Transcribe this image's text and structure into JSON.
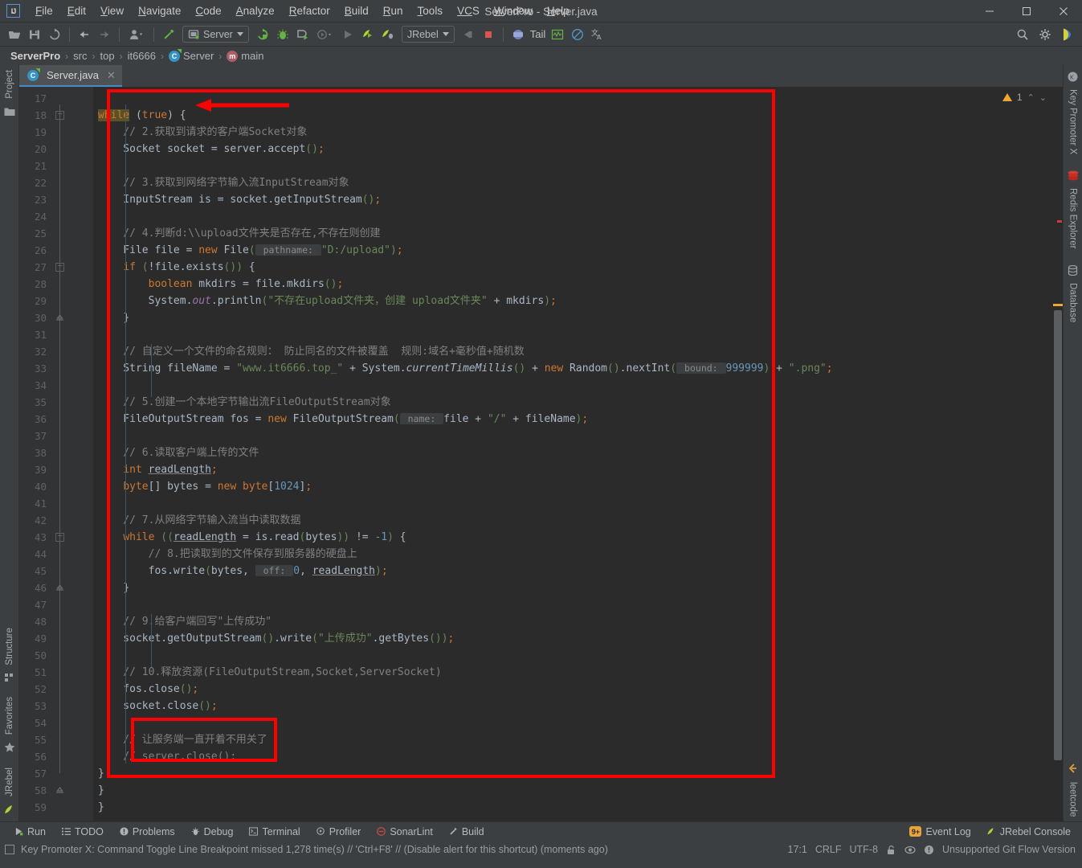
{
  "window": {
    "title": "ServerPro - Server.java",
    "minimize_label": "—",
    "maximize_label": "□",
    "close_label": "✕",
    "logo_text": "IJ"
  },
  "menubar": {
    "items": [
      {
        "label": "File"
      },
      {
        "label": "Edit"
      },
      {
        "label": "View"
      },
      {
        "label": "Navigate"
      },
      {
        "label": "Code"
      },
      {
        "label": "Analyze"
      },
      {
        "label": "Refactor"
      },
      {
        "label": "Build"
      },
      {
        "label": "Run"
      },
      {
        "label": "Tools"
      },
      {
        "label": "VCS"
      },
      {
        "label": "Window"
      },
      {
        "label": "Help"
      }
    ]
  },
  "toolbar": {
    "run_config_label": "Server",
    "jrebel_label": "JRebel",
    "tail_label": "Tail",
    "icons": [
      "open-folder-icon",
      "save-all-icon",
      "sync-icon",
      "back-arrow-icon",
      "forward-arrow-icon",
      "profile-dropdown-icon",
      "build-hammer-icon",
      "run-config-selector",
      "rerun-icon",
      "debug-bug-icon",
      "run-with-coverage-icon",
      "profiler-icon",
      "run-icon",
      "jrebel-run-icon",
      "jrebel-debug-icon",
      "jrebel-selector",
      "stop-gray-icon",
      "stop-red-icon",
      "tail-icon",
      "monitor-icon",
      "forbidden-icon",
      "translate-icon",
      "search-icon",
      "settings-gear-icon",
      "ide-profile-icon"
    ]
  },
  "breadcrumb": {
    "items": [
      {
        "label": "ServerPro",
        "icon": "",
        "bold": true
      },
      {
        "label": "src",
        "icon": ""
      },
      {
        "label": "top",
        "icon": ""
      },
      {
        "label": "it6666",
        "icon": ""
      },
      {
        "label": "Server",
        "icon": "class-icon"
      },
      {
        "label": "main",
        "icon": "method-icon"
      }
    ],
    "separator": "›"
  },
  "editor_tabs": [
    {
      "label": "Server.java",
      "icon": "java-class-icon",
      "close": "✕",
      "active": true
    }
  ],
  "inspection_widget": {
    "warning_count": "1",
    "up_chevron": "⌃",
    "down_chevron": "⌄"
  },
  "left_toolwindows": [
    {
      "label": "Project",
      "icon": "project-folder-icon"
    },
    {
      "label": "Structure",
      "icon": "structure-icon"
    },
    {
      "label": "Favorites",
      "icon": "star-icon"
    },
    {
      "label": "JRebel",
      "icon": "jrebel-leaf-icon"
    }
  ],
  "right_toolwindows": [
    {
      "label": "Key Promoter X",
      "icon": "key-promoter-icon"
    },
    {
      "label": "Redis Explorer",
      "icon": "redis-icon"
    },
    {
      "label": "Database",
      "icon": "database-icon"
    }
  ],
  "code": {
    "first_line_number": 17,
    "lines": [
      {
        "n": 17,
        "fold": "",
        "tokens": []
      },
      {
        "n": 18,
        "fold": "minus",
        "tokens": [
          {
            "t": "while",
            "c": "hl-kw"
          },
          {
            "t": " ",
            "c": "txt"
          },
          {
            "t": "(",
            "c": "pun"
          },
          {
            "t": "true",
            "c": "kw"
          },
          {
            "t": ")",
            "c": "pun"
          },
          {
            "t": " ",
            "c": "txt"
          },
          {
            "t": "{",
            "c": "pun"
          }
        ]
      },
      {
        "n": 19,
        "fold": "",
        "tokens": [
          {
            "t": "    // 2.获取到请求的客户端Socket对象",
            "c": "cmt"
          }
        ]
      },
      {
        "n": 20,
        "fold": "",
        "tokens": [
          {
            "t": "    Socket socket = server.accept",
            "c": "txt"
          },
          {
            "t": "()",
            "c": "grn"
          },
          {
            "t": ";",
            "c": "semi"
          }
        ]
      },
      {
        "n": 21,
        "fold": "",
        "tokens": []
      },
      {
        "n": 22,
        "fold": "",
        "tokens": [
          {
            "t": "    // 3.获取到网络字节输入流InputStream对象",
            "c": "cmt"
          }
        ]
      },
      {
        "n": 23,
        "fold": "",
        "tokens": [
          {
            "t": "    InputStream is = socket.getInputStream",
            "c": "txt"
          },
          {
            "t": "()",
            "c": "grn"
          },
          {
            "t": ";",
            "c": "semi"
          }
        ]
      },
      {
        "n": 24,
        "fold": "",
        "tokens": []
      },
      {
        "n": 25,
        "fold": "",
        "tokens": [
          {
            "t": "    // 4.判断d:\\\\upload文件夹是否存在,不存在则创建",
            "c": "cmt"
          }
        ]
      },
      {
        "n": 26,
        "fold": "",
        "tokens": [
          {
            "t": "    File file = ",
            "c": "txt"
          },
          {
            "t": "new",
            "c": "kw"
          },
          {
            "t": " File",
            "c": "txt"
          },
          {
            "t": "(",
            "c": "grn"
          },
          {
            "t": " pathname: ",
            "c": "hint"
          },
          {
            "t": "\"D:/upload\"",
            "c": "str"
          },
          {
            "t": ")",
            "c": "grn"
          },
          {
            "t": ";",
            "c": "semi"
          }
        ]
      },
      {
        "n": 27,
        "fold": "minus",
        "tokens": [
          {
            "t": "    ",
            "c": "txt"
          },
          {
            "t": "if",
            "c": "kw"
          },
          {
            "t": " ",
            "c": "txt"
          },
          {
            "t": "(",
            "c": "grn"
          },
          {
            "t": "!file.exists",
            "c": "txt"
          },
          {
            "t": "()",
            "c": "grn"
          },
          {
            "t": ")",
            "c": "grn"
          },
          {
            "t": " ",
            "c": "txt"
          },
          {
            "t": "{",
            "c": "pun"
          }
        ]
      },
      {
        "n": 28,
        "fold": "",
        "tokens": [
          {
            "t": "        ",
            "c": "txt"
          },
          {
            "t": "boolean",
            "c": "kw"
          },
          {
            "t": " mkdirs = file.mkdirs",
            "c": "txt"
          },
          {
            "t": "()",
            "c": "grn"
          },
          {
            "t": ";",
            "c": "semi"
          }
        ]
      },
      {
        "n": 29,
        "fold": "",
        "tokens": [
          {
            "t": "        System.",
            "c": "txt"
          },
          {
            "t": "out",
            "c": "fld ital"
          },
          {
            "t": ".println",
            "c": "txt"
          },
          {
            "t": "(",
            "c": "grn"
          },
          {
            "t": "\"不存在upload文件夹，创建 upload文件夹\"",
            "c": "str"
          },
          {
            "t": " + mkdirs",
            "c": "txt"
          },
          {
            "t": ")",
            "c": "grn"
          },
          {
            "t": ";",
            "c": "semi"
          }
        ]
      },
      {
        "n": 30,
        "fold": "end",
        "tokens": [
          {
            "t": "    ",
            "c": "txt"
          },
          {
            "t": "}",
            "c": "pun"
          }
        ]
      },
      {
        "n": 31,
        "fold": "",
        "tokens": []
      },
      {
        "n": 32,
        "fold": "",
        "tokens": [
          {
            "t": "    // 自定义一个文件的命名规则： 防止同名的文件被覆盖  规则:域名+毫秒值+随机数",
            "c": "cmt"
          }
        ]
      },
      {
        "n": 33,
        "fold": "",
        "tokens": [
          {
            "t": "    String fileName = ",
            "c": "txt"
          },
          {
            "t": "\"www.it6666.top_\"",
            "c": "str"
          },
          {
            "t": " + System.",
            "c": "txt"
          },
          {
            "t": "currentTimeMillis",
            "c": "txt ital"
          },
          {
            "t": "()",
            "c": "grn"
          },
          {
            "t": " + ",
            "c": "txt"
          },
          {
            "t": "new",
            "c": "kw"
          },
          {
            "t": " Random",
            "c": "txt"
          },
          {
            "t": "()",
            "c": "grn"
          },
          {
            "t": ".nextInt",
            "c": "txt"
          },
          {
            "t": "(",
            "c": "grn"
          },
          {
            "t": " bound: ",
            "c": "hint"
          },
          {
            "t": "999999",
            "c": "num"
          },
          {
            "t": ")",
            "c": "grn"
          },
          {
            "t": " + ",
            "c": "txt"
          },
          {
            "t": "\".png\"",
            "c": "str"
          },
          {
            "t": ";",
            "c": "semi"
          }
        ]
      },
      {
        "n": 34,
        "fold": "",
        "tokens": []
      },
      {
        "n": 35,
        "fold": "",
        "tokens": [
          {
            "t": "    // 5.创建一个本地字节输出流FileOutputStream对象",
            "c": "cmt"
          }
        ]
      },
      {
        "n": 36,
        "fold": "",
        "tokens": [
          {
            "t": "    FileOutputStream fos = ",
            "c": "txt"
          },
          {
            "t": "new",
            "c": "kw"
          },
          {
            "t": " FileOutputStream",
            "c": "txt"
          },
          {
            "t": "(",
            "c": "grn"
          },
          {
            "t": " name: ",
            "c": "hint"
          },
          {
            "t": "file + ",
            "c": "txt"
          },
          {
            "t": "\"/\"",
            "c": "str"
          },
          {
            "t": " + fileName",
            "c": "txt"
          },
          {
            "t": ")",
            "c": "grn"
          },
          {
            "t": ";",
            "c": "semi"
          }
        ]
      },
      {
        "n": 37,
        "fold": "",
        "tokens": []
      },
      {
        "n": 38,
        "fold": "",
        "tokens": [
          {
            "t": "    // 6.读取客户端上传的文件",
            "c": "cmt"
          }
        ]
      },
      {
        "n": 39,
        "fold": "",
        "tokens": [
          {
            "t": "    ",
            "c": "txt"
          },
          {
            "t": "int",
            "c": "kw"
          },
          {
            "t": " ",
            "c": "txt"
          },
          {
            "t": "readLength",
            "c": "txt und"
          },
          {
            "t": ";",
            "c": "semi"
          }
        ]
      },
      {
        "n": 40,
        "fold": "",
        "tokens": [
          {
            "t": "    ",
            "c": "txt"
          },
          {
            "t": "byte",
            "c": "kw"
          },
          {
            "t": "[]",
            "c": "pun"
          },
          {
            "t": " bytes = ",
            "c": "txt"
          },
          {
            "t": "new",
            "c": "kw"
          },
          {
            "t": " ",
            "c": "txt"
          },
          {
            "t": "byte",
            "c": "kw"
          },
          {
            "t": "[",
            "c": "pun"
          },
          {
            "t": "1024",
            "c": "num"
          },
          {
            "t": "]",
            "c": "pun"
          },
          {
            "t": ";",
            "c": "semi"
          }
        ]
      },
      {
        "n": 41,
        "fold": "",
        "tokens": []
      },
      {
        "n": 42,
        "fold": "",
        "tokens": [
          {
            "t": "    // 7.从网络字节输入流当中读取数据",
            "c": "cmt"
          }
        ]
      },
      {
        "n": 43,
        "fold": "minus",
        "tokens": [
          {
            "t": "    ",
            "c": "txt"
          },
          {
            "t": "while",
            "c": "kw"
          },
          {
            "t": " ",
            "c": "txt"
          },
          {
            "t": "((",
            "c": "grn"
          },
          {
            "t": "readLength",
            "c": "txt und"
          },
          {
            "t": " = is.read",
            "c": "txt"
          },
          {
            "t": "(",
            "c": "grn"
          },
          {
            "t": "bytes",
            "c": "txt"
          },
          {
            "t": "))",
            "c": "grn"
          },
          {
            "t": " != ",
            "c": "txt"
          },
          {
            "t": "-1",
            "c": "num"
          },
          {
            "t": ")",
            "c": "grn"
          },
          {
            "t": " ",
            "c": "txt"
          },
          {
            "t": "{",
            "c": "pun"
          }
        ]
      },
      {
        "n": 44,
        "fold": "",
        "tokens": [
          {
            "t": "        // 8.把读取到的文件保存到服务器的硬盘上",
            "c": "cmt"
          }
        ]
      },
      {
        "n": 45,
        "fold": "",
        "tokens": [
          {
            "t": "        fos.write",
            "c": "txt"
          },
          {
            "t": "(",
            "c": "grn"
          },
          {
            "t": "bytes, ",
            "c": "txt"
          },
          {
            "t": " off: ",
            "c": "hint"
          },
          {
            "t": "0",
            "c": "num"
          },
          {
            "t": ", ",
            "c": "txt"
          },
          {
            "t": "readLength",
            "c": "txt und"
          },
          {
            "t": ")",
            "c": "grn"
          },
          {
            "t": ";",
            "c": "semi"
          }
        ]
      },
      {
        "n": 46,
        "fold": "end",
        "tokens": [
          {
            "t": "    ",
            "c": "txt"
          },
          {
            "t": "}",
            "c": "pun"
          }
        ]
      },
      {
        "n": 47,
        "fold": "",
        "tokens": []
      },
      {
        "n": 48,
        "fold": "",
        "tokens": [
          {
            "t": "    // 9.给客户端回写\"上传成功\"",
            "c": "cmt"
          }
        ]
      },
      {
        "n": 49,
        "fold": "",
        "tokens": [
          {
            "t": "    socket.getOutputStream",
            "c": "txt"
          },
          {
            "t": "()",
            "c": "grn"
          },
          {
            "t": ".write",
            "c": "txt"
          },
          {
            "t": "(",
            "c": "grn"
          },
          {
            "t": "\"上传成功\"",
            "c": "str"
          },
          {
            "t": ".getBytes",
            "c": "txt"
          },
          {
            "t": "()",
            "c": "grn"
          },
          {
            "t": ")",
            "c": "grn"
          },
          {
            "t": ";",
            "c": "semi"
          }
        ]
      },
      {
        "n": 50,
        "fold": "",
        "tokens": []
      },
      {
        "n": 51,
        "fold": "",
        "tokens": [
          {
            "t": "    // 10.释放资源(FileOutputStream,Socket,ServerSocket)",
            "c": "cmt"
          }
        ]
      },
      {
        "n": 52,
        "fold": "",
        "tokens": [
          {
            "t": "    fos.close",
            "c": "txt"
          },
          {
            "t": "()",
            "c": "grn"
          },
          {
            "t": ";",
            "c": "semi"
          }
        ]
      },
      {
        "n": 53,
        "fold": "",
        "tokens": [
          {
            "t": "    socket.close",
            "c": "txt"
          },
          {
            "t": "()",
            "c": "grn"
          },
          {
            "t": ";",
            "c": "semi"
          }
        ]
      },
      {
        "n": 54,
        "fold": "",
        "tokens": []
      },
      {
        "n": 55,
        "fold": "",
        "tokens": [
          {
            "t": "    // 让服务端一直开着不用关了",
            "c": "cmt"
          }
        ]
      },
      {
        "n": 56,
        "fold": "",
        "tokens": [
          {
            "t": "    // server.close();",
            "c": "cmt"
          }
        ]
      },
      {
        "n": 57,
        "fold": "",
        "tokens": [
          {
            "t": "}",
            "c": "pun"
          }
        ]
      },
      {
        "n": 58,
        "fold": "end",
        "tokens": [
          {
            "t": "}",
            "c": "pun"
          }
        ]
      },
      {
        "n": 59,
        "fold": "",
        "tokens": [
          {
            "t": "}",
            "c": "pun"
          }
        ]
      }
    ]
  },
  "bottom_toolwindows": [
    {
      "label": "Run",
      "icon": "run-triangle-icon"
    },
    {
      "label": "TODO",
      "icon": "todo-list-icon"
    },
    {
      "label": "Problems",
      "icon": "problems-icon"
    },
    {
      "label": "Debug",
      "icon": "debug-bug-icon"
    },
    {
      "label": "Terminal",
      "icon": "terminal-icon"
    },
    {
      "label": "Profiler",
      "icon": "profiler-icon"
    },
    {
      "label": "SonarLint",
      "icon": "sonarlint-icon"
    },
    {
      "label": "Build",
      "icon": "build-hammer-icon"
    }
  ],
  "bottom_right": [
    {
      "label": "Event Log",
      "icon": "event-log-badge-icon",
      "badge": "9+"
    },
    {
      "label": "JRebel Console",
      "icon": "jrebel-leaf-icon"
    }
  ],
  "statusbar": {
    "message": "Key Promoter X: Command Toggle Line Breakpoint missed 1,278 time(s) // 'Ctrl+F8' // (Disable alert for this shortcut) (moments ago)",
    "caret_position": "17:1",
    "line_separator": "CRLF",
    "encoding": "UTF-8",
    "git_status": "Unsupported Git Flow Version",
    "lock_icon": "read-only-lock-icon",
    "inspection_icon": "inspection-eye-icon",
    "notification_icon": "notification-icon"
  },
  "colors": {
    "accent": "#4a88c7",
    "annotation_red": "#ff0000",
    "editor_bg": "#2b2b2b",
    "chrome_bg": "#3c3f41",
    "gutter_bg": "#313335",
    "warning_yellow": "#f0a732"
  }
}
